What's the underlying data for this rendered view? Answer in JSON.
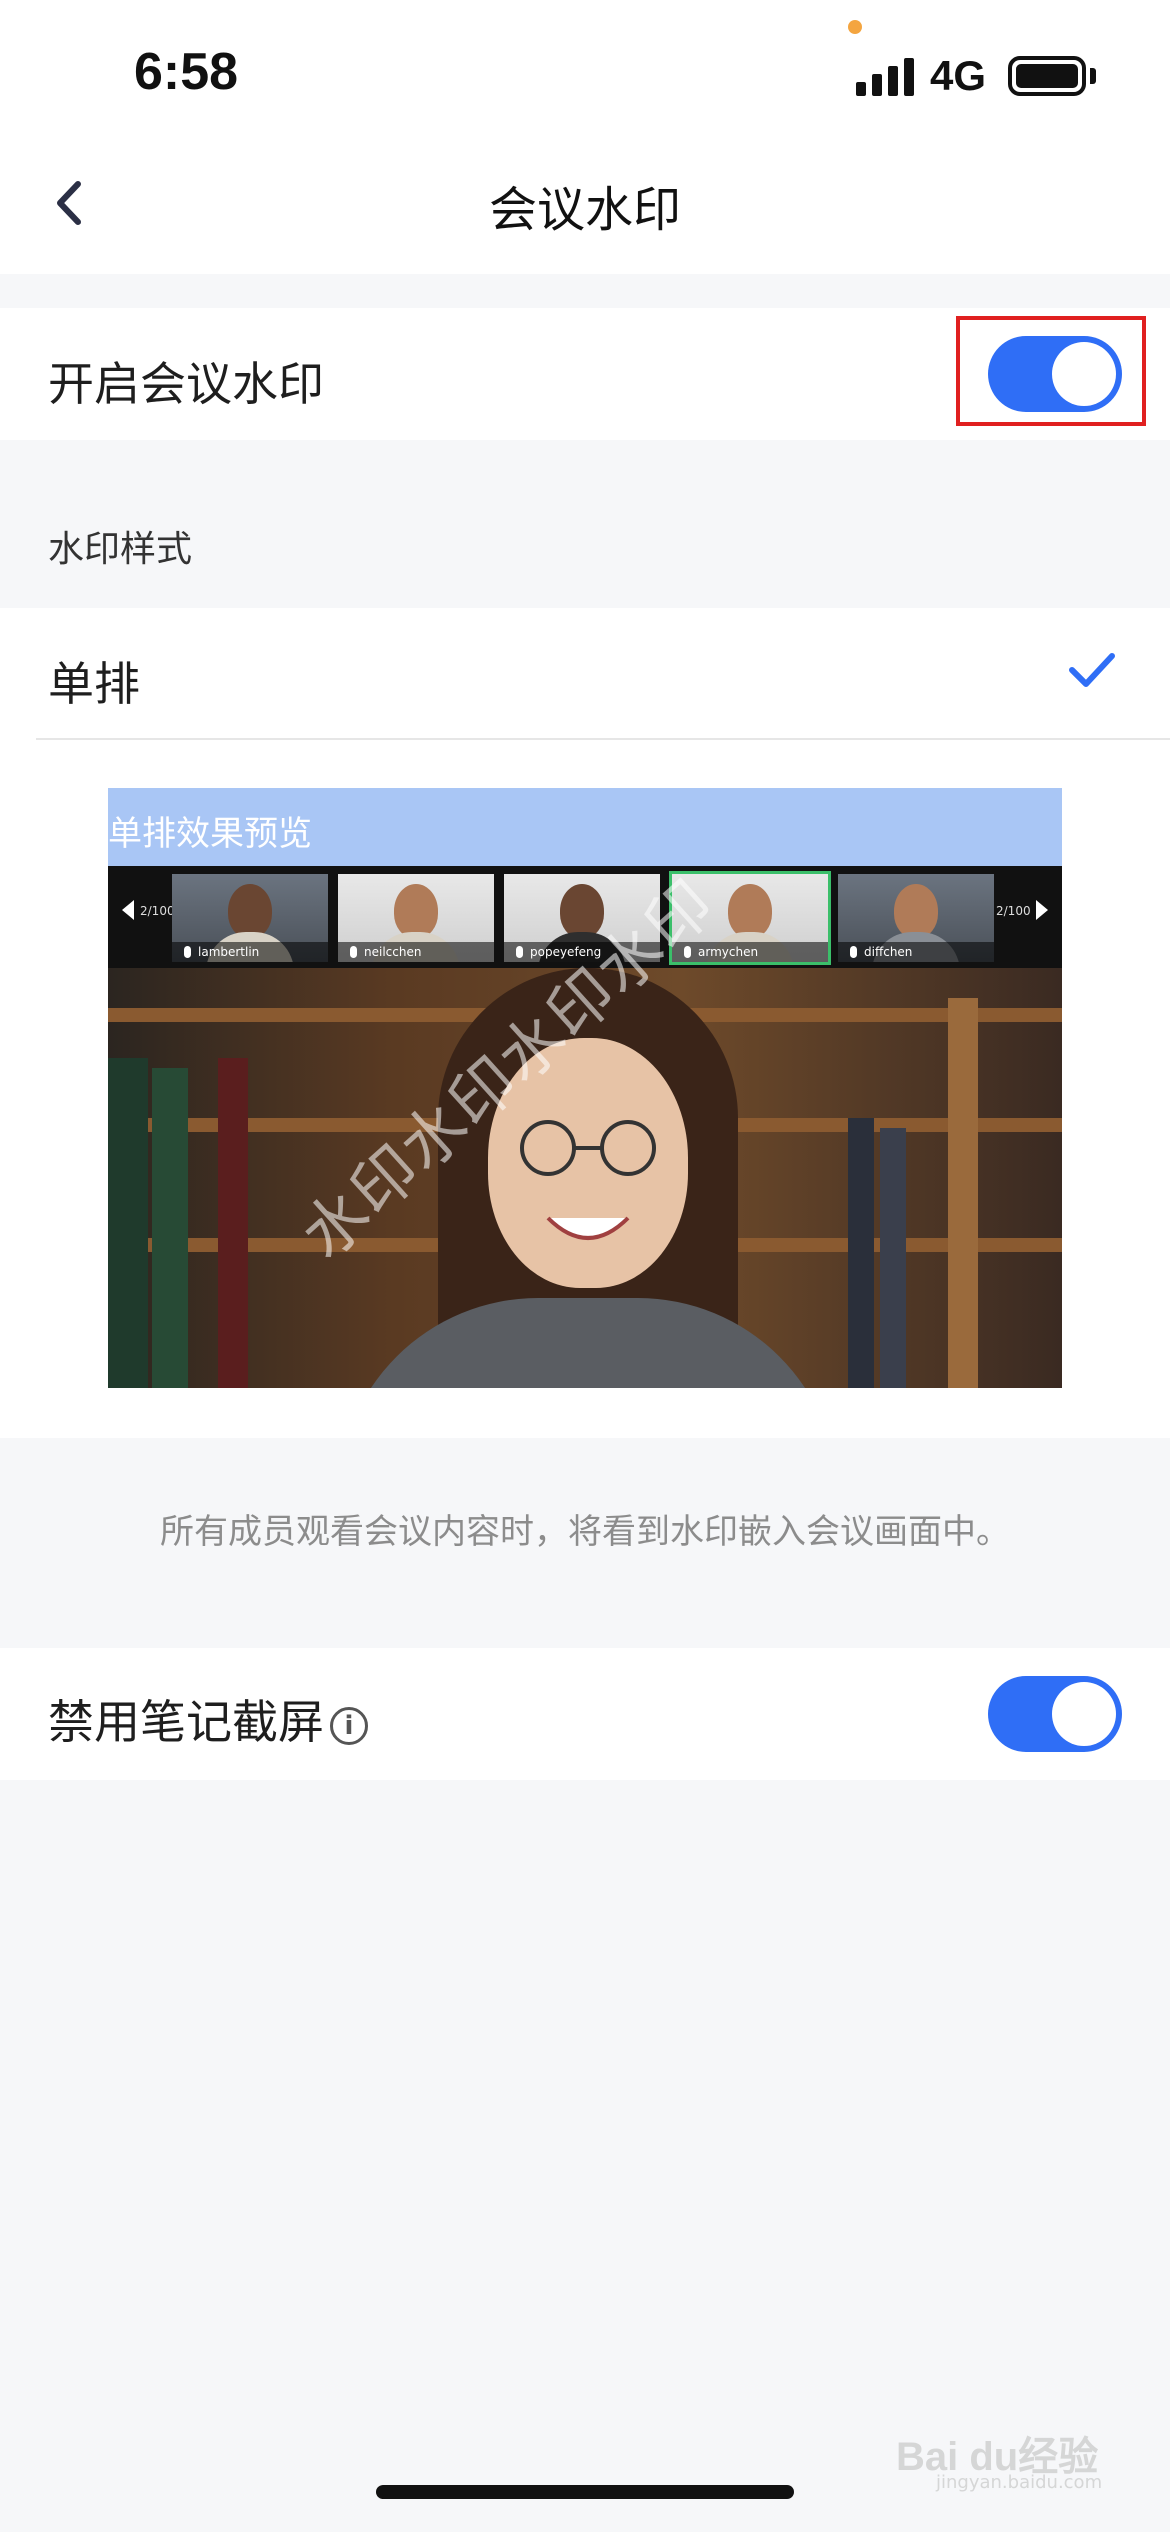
{
  "status_bar": {
    "time": "6:58",
    "network": "4G"
  },
  "nav": {
    "title": "会议水印"
  },
  "watermark_setting": {
    "label": "开启会议水印",
    "enabled": true
  },
  "style_section": {
    "header": "水印样式",
    "selected_option": "单排"
  },
  "preview": {
    "banner_text": "单排效果预览",
    "page_left": "2/100",
    "page_right": "2/100",
    "participants": [
      "lambertlin",
      "neilcchen",
      "popeyefeng",
      "armychen",
      "diffchen"
    ],
    "watermark_text": "水印水印水印水印"
  },
  "description": "所有成员观看会议内容时，将看到水印嵌入会议画面中。",
  "screenshot_setting": {
    "label": "禁用笔记截屏",
    "info_glyph": "i",
    "enabled": true
  },
  "site_watermark": {
    "brand": "Bai du经验",
    "sub": "jingyan.baidu.com"
  },
  "colors": {
    "accent": "#2f6ef6",
    "highlight": "#e02020",
    "banner": "#a9c6f5"
  }
}
